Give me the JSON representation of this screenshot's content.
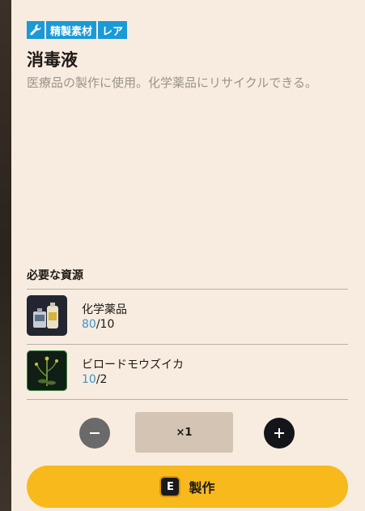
{
  "item": {
    "tags": [
      "精製素材",
      "レア"
    ],
    "name": "消毒液",
    "description": "医療品の製作に使用。化学薬品にリサイクルできる。"
  },
  "requirements": {
    "heading": "必要な資源",
    "resources": [
      {
        "name": "化学薬品",
        "have": "80",
        "need": "/10",
        "icon": "chemicals-icon"
      },
      {
        "name": "ビロードモウズイカ",
        "have": "10",
        "need": "/2",
        "icon": "mullein-plant-icon"
      }
    ]
  },
  "quantity": {
    "value": "×1"
  },
  "craft": {
    "key": "E",
    "label": "製作"
  },
  "colors": {
    "tag": "#1a9ad6",
    "button": "#f8b91c",
    "count": "#3f93c6"
  }
}
